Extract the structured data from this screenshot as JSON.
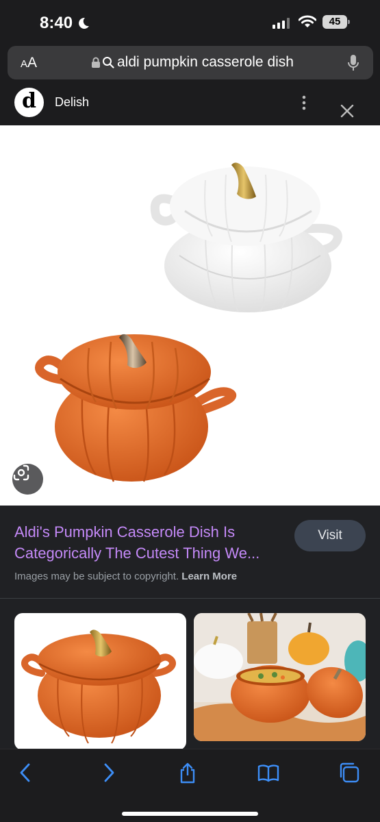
{
  "status_bar": {
    "time": "8:40",
    "battery": "45"
  },
  "address_bar": {
    "aa_label_big": "A",
    "aa_label_small": "A",
    "query": "aldi pumpkin casserole dish"
  },
  "site": {
    "logo_letter": "d",
    "name": "Delish"
  },
  "result": {
    "title": "Aldi's Pumpkin Casserole Dish Is Categorically The Cutest Thing We...",
    "visit_label": "Visit",
    "copyright_text": "Images may be subject to copyright.",
    "learn_more": "Learn More"
  },
  "colors": {
    "title_link": "#c58af9",
    "toolbar_icon": "#3d8ef7",
    "pumpkin_orange": "#e06a2a",
    "background_dark": "#1c1c1e"
  },
  "icons": {
    "moon": "moon-icon",
    "lock": "lock-icon",
    "search": "search-icon",
    "mic": "microphone-icon",
    "more": "more-vertical-icon",
    "close": "close-icon",
    "lens": "google-lens-icon",
    "back": "chevron-left-icon",
    "forward": "chevron-right-icon",
    "share": "share-icon",
    "bookmarks": "book-icon",
    "tabs": "tabs-icon"
  }
}
